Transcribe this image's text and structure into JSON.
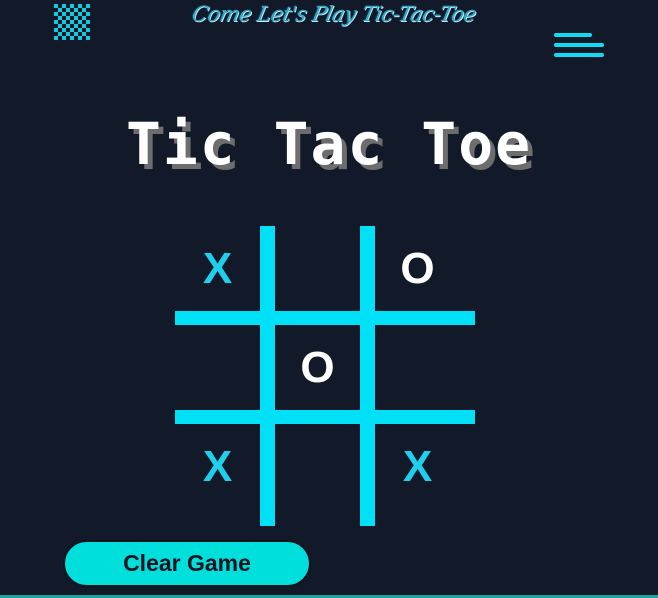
{
  "header": {
    "logo_icon": "checkerboard-icon",
    "tagline": "Come Let's Play Tic-Tac-Toe",
    "menu_icon": "hamburger-menu-icon"
  },
  "title": "Tic Tac Toe",
  "board": {
    "cells": [
      "X",
      "",
      "O",
      "",
      "O",
      "",
      "X",
      "",
      "X"
    ]
  },
  "actions": {
    "clear_label": "Clear Game"
  },
  "colors": {
    "background": "#121a2a",
    "accent": "#00e1f7",
    "x_mark": "#1fd0ee",
    "o_mark": "#ffffff",
    "button": "#00dfdc"
  }
}
